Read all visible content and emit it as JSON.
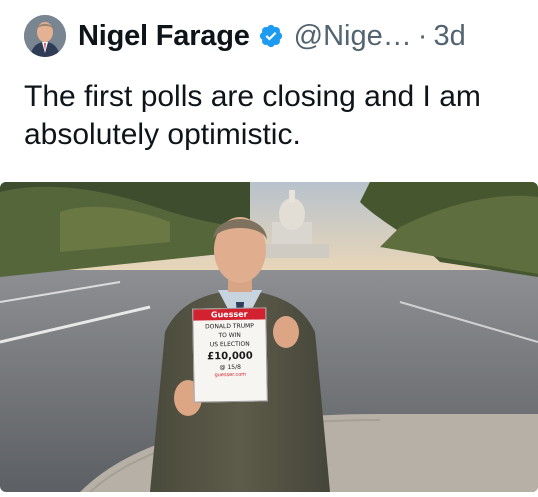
{
  "tweet": {
    "author_name": "Nigel Farage",
    "handle": "@Nige…",
    "separator": "·",
    "time": "3d",
    "text": "The first polls are closing and I am absolutely optimistic."
  },
  "icons": {
    "verified": "verified-badge-icon",
    "avatar": "profile-avatar"
  },
  "colors": {
    "verified_blue": "#1d9bf0",
    "secondary_text": "#536471",
    "primary_text": "#0f1419"
  },
  "photo_sign": {
    "brand": "Guesser",
    "line1": "DONALD TRUMP",
    "line2": "TO WIN",
    "line3": "US ELECTION",
    "amount": "£10,000",
    "odds": "@ 15/8",
    "site": "guesser.com"
  }
}
